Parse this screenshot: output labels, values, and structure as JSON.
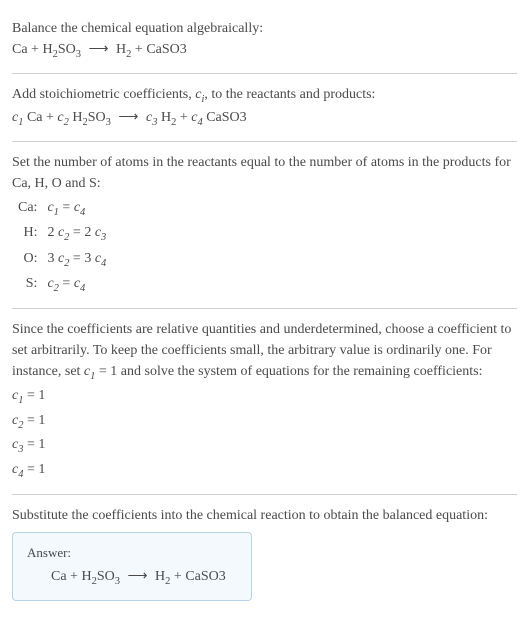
{
  "section1": {
    "intro": "Balance the chemical equation algebraically:",
    "equation": "Ca + H₂SO₃ ⟶ H₂ + CaSO3"
  },
  "section2": {
    "intro_before_ci": "Add stoichiometric coefficients, ",
    "ci": "cᵢ",
    "intro_after_ci": ", to the reactants and products:",
    "equation_c1": "c₁",
    "equation_ca": " Ca + ",
    "equation_c2": "c₂",
    "equation_h2so3": " H₂SO₃ ⟶ ",
    "equation_c3": "c₃",
    "equation_h2": " H₂ + ",
    "equation_c4": "c₄",
    "equation_caso3": " CaSO3"
  },
  "section3": {
    "intro": "Set the number of atoms in the reactants equal to the number of atoms in the products for Ca, H, O and S:",
    "rows": [
      {
        "label": "Ca:",
        "eq_l": "c₁",
        "eq_r": "c₄"
      },
      {
        "label": "H:",
        "eq_l": "2 c₂",
        "eq_r": "2 c₃"
      },
      {
        "label": "O:",
        "eq_l": "3 c₂",
        "eq_r": "3 c₄"
      },
      {
        "label": "S:",
        "eq_l": "c₂",
        "eq_r": "c₄"
      }
    ]
  },
  "section4": {
    "intro_a": "Since the coefficients are relative quantities and underdetermined, choose a coefficient to set arbitrarily. To keep the coefficients small, the arbitrary value is ordinarily one. For instance, set ",
    "intro_c1": "c₁",
    "intro_b": " = 1 and solve the system of equations for the remaining coefficients:",
    "coefs": [
      {
        "c": "c₁",
        "v": " = 1"
      },
      {
        "c": "c₂",
        "v": " = 1"
      },
      {
        "c": "c₃",
        "v": " = 1"
      },
      {
        "c": "c₄",
        "v": " = 1"
      }
    ]
  },
  "section5": {
    "intro": "Substitute the coefficients into the chemical reaction to obtain the balanced equation:",
    "answer_label": "Answer:",
    "answer_equation": "Ca + H₂SO₃ ⟶ H₂ + CaSO3"
  }
}
